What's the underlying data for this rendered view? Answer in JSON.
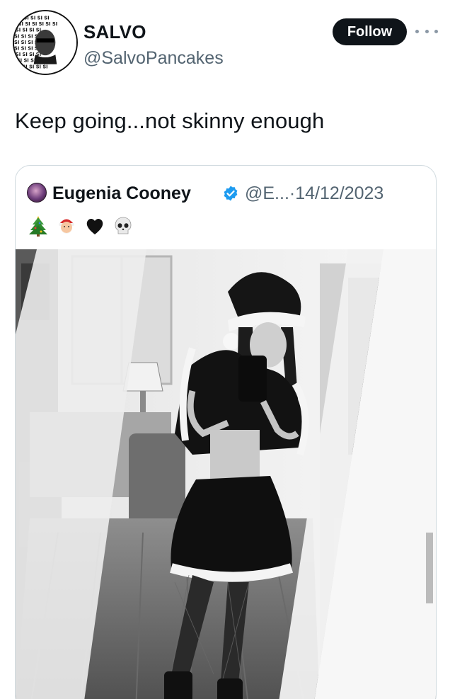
{
  "tweet": {
    "author_name": "SALVO",
    "author_handle": "@SalvoPancakes",
    "follow_label": "Follow",
    "text": "Keep going...not skinny enough"
  },
  "quoted": {
    "author_name": "Eugenia Cooney",
    "author_handle_date": "@E...·14/12/2023",
    "emojis": [
      "christmas-tree",
      "santa",
      "black-heart",
      "skull"
    ]
  },
  "colors": {
    "text_primary": "#0f1419",
    "text_secondary": "#536471",
    "border": "#cfd9de",
    "verified": "#1d9bf0",
    "follow_bg": "#0f1419"
  }
}
